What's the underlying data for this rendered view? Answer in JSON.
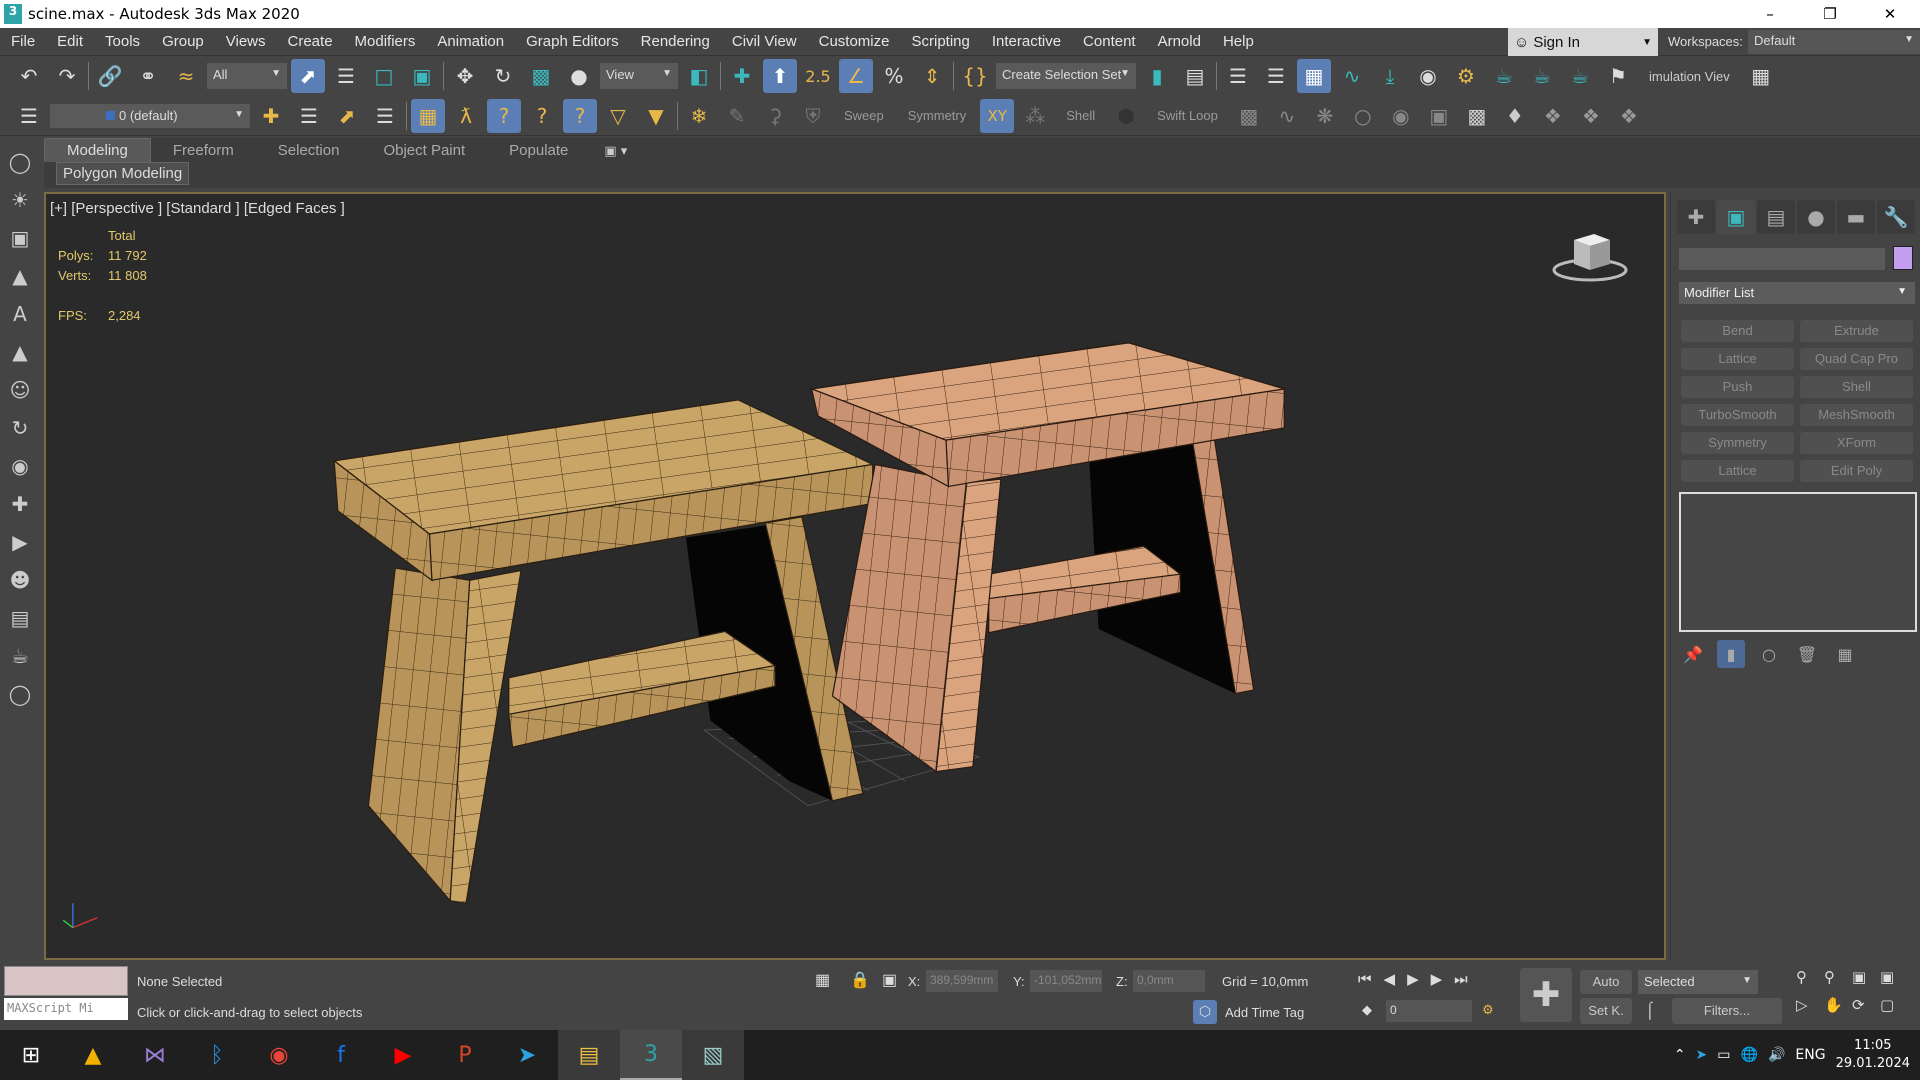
{
  "window": {
    "title": "scine.max - Autodesk 3ds Max 2020",
    "app_icon": "3",
    "controls": [
      "minimize-icon",
      "restore-icon",
      "close-icon"
    ]
  },
  "menu": [
    "File",
    "Edit",
    "Tools",
    "Group",
    "Views",
    "Create",
    "Modifiers",
    "Animation",
    "Graph Editors",
    "Rendering",
    "Civil View",
    "Customize",
    "Scripting",
    "Interactive",
    "Content",
    "Arnold",
    "Help"
  ],
  "account": {
    "sign_in": "Sign In",
    "workspaces_label": "Workspaces:",
    "workspace": "Default"
  },
  "toolbar1": {
    "filter": "All",
    "ref_coord": "View",
    "selection_set": "Create Selection Set",
    "simulation": "imulation Viev",
    "snap_label": "2.5"
  },
  "toolbar2": {
    "layer": "0 (default)",
    "labels": [
      "Sweep",
      "Symmetry",
      "Shell",
      "Swift Loop"
    ]
  },
  "ribbon": {
    "tabs": [
      "Modeling",
      "Freeform",
      "Selection",
      "Object Paint",
      "Populate"
    ],
    "active": 0,
    "panel": "Polygon Modeling"
  },
  "viewport": {
    "label": "[+] [Perspective ] [Standard ] [Edged Faces ]",
    "stats": {
      "header": "Total",
      "polys_label": "Polys:",
      "polys": "11 792",
      "verts_label": "Verts:",
      "verts": "11 808",
      "fps_label": "FPS:",
      "fps": "2,284"
    }
  },
  "command_panel": {
    "tabs": [
      "create-icon",
      "modify-icon",
      "hierarchy-icon",
      "motion-icon",
      "display-icon",
      "utilities-icon"
    ],
    "object_color": "#c49ff0",
    "modifier_list": "Modifier List",
    "modifier_buttons": [
      "Bend",
      "Extrude",
      "Lattice",
      "Quad Cap Pro",
      "Push",
      "Shell",
      "TurboSmooth",
      "MeshSmooth",
      "Symmetry",
      "XForm",
      "Lattice",
      "Edit Poly"
    ]
  },
  "status": {
    "maxscript": "MAXScript Mi",
    "selection": "None Selected",
    "prompt": "Click or click-and-drag to select objects",
    "x_label": "X:",
    "x": "389,599mm",
    "y_label": "Y:",
    "y": "-101,052mm",
    "z_label": "Z:",
    "z": "0,0mm",
    "grid": "Grid = 10,0mm",
    "add_time_tag": "Add Time Tag",
    "frame": "0",
    "auto": "Auto",
    "set_key": "Set K.",
    "key_filter": "Selected",
    "filters": "Filters..."
  },
  "taskbar": {
    "apps": [
      "windows-start",
      "autocad",
      "visual-studio",
      "bluetooth",
      "chrome",
      "facebook",
      "youtube",
      "powerpoint",
      "telegram",
      "file-explorer",
      "3ds-max",
      "notes"
    ],
    "language": "ENG",
    "time": "11:05",
    "date": "29.01.2024"
  },
  "colors": {
    "accent": "#5b7fb5",
    "viewport_border": "#7a6c40",
    "stats": "#e3c86b",
    "wood_light": "#c9a567",
    "wood_pink": "#d6a07c"
  }
}
